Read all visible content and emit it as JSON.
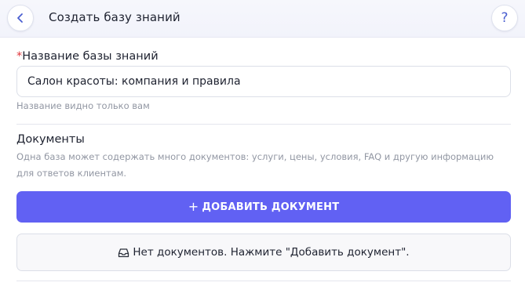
{
  "header": {
    "title": "Создать базу знаний",
    "back_icon": "chevron-left-icon",
    "help_label": "?"
  },
  "name_field": {
    "required_mark": "*",
    "label": "Название базы знаний",
    "value": "Салон красоты: компания и правила",
    "hint": "Название видно только вам"
  },
  "documents": {
    "title": "Документы",
    "description": "Одна база может содержать много документов: услуги, цены, условия, FAQ и другую информацию для ответов клиентам.",
    "add_button_icon": "+",
    "add_button_label": "ДОБАВИТЬ ДОКУМЕНТ",
    "empty_icon": "inbox-icon",
    "empty_text": "Нет документов. Нажмите \"Добавить документ\"."
  },
  "colors": {
    "accent": "#6161f3",
    "required": "#e0353b",
    "icon_blue": "#4a5fd0"
  }
}
